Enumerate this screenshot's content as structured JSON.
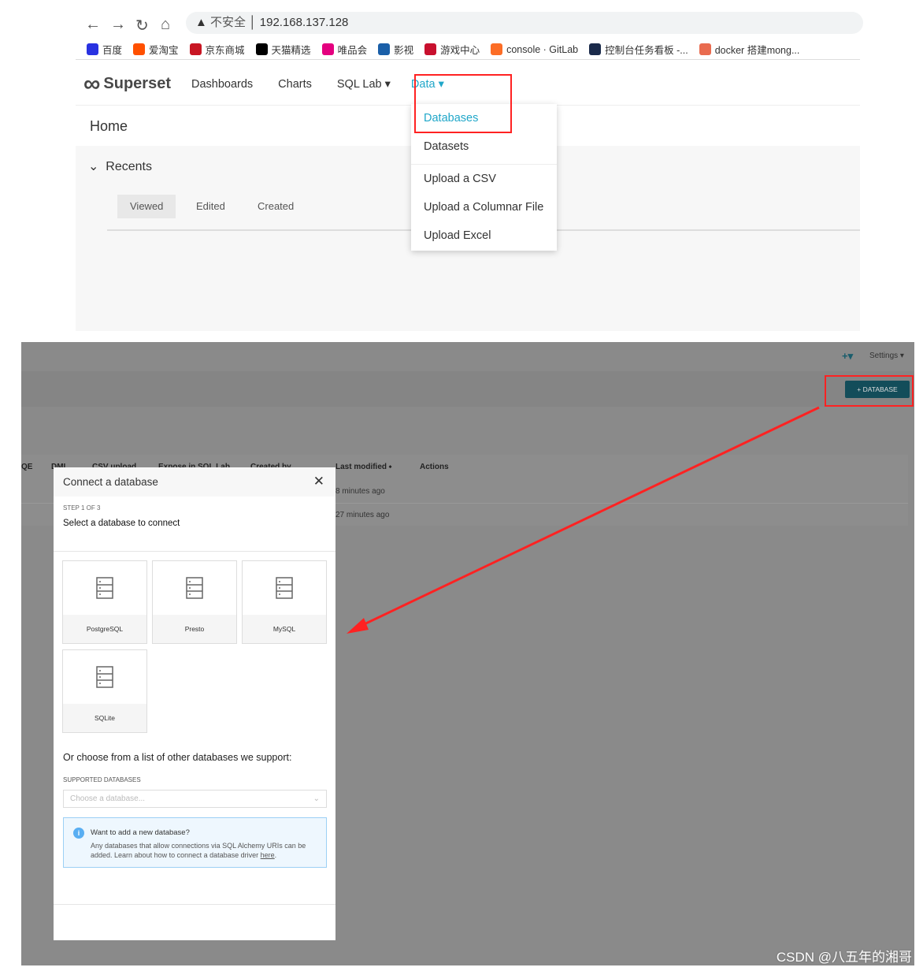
{
  "browser": {
    "security": "不安全",
    "url": "192.168.137.128",
    "bookmarks": [
      {
        "label": "百度",
        "color": "#2932e1"
      },
      {
        "label": "爱淘宝",
        "color": "#ff5000"
      },
      {
        "label": "京东商城",
        "color": "#c81623"
      },
      {
        "label": "天猫精选",
        "color": "#000"
      },
      {
        "label": "唯品会",
        "color": "#e4007f"
      },
      {
        "label": "影视",
        "color": "#1a5fa8"
      },
      {
        "label": "游戏中心",
        "color": "#c8102e"
      },
      {
        "label": "console · GitLab",
        "color": "#fc6d26"
      },
      {
        "label": "控制台任务看板 -...",
        "color": "#1a2a4a"
      },
      {
        "label": "docker 搭建mong...",
        "color": "#e96b4f"
      }
    ]
  },
  "superset": {
    "brand": "Superset",
    "menu": [
      "Dashboards",
      "Charts",
      "SQL Lab",
      "Data"
    ],
    "page_title": "Home",
    "recents": "Recents",
    "tabs": [
      "Viewed",
      "Edited",
      "Created"
    ],
    "data_menu": [
      "Databases",
      "Datasets",
      "Upload a CSV",
      "Upload a Columnar File",
      "Upload Excel"
    ],
    "accent": "#20a7c9"
  },
  "db_page": {
    "settings": "Settings",
    "add_button": "+ DATABASE",
    "columns": [
      "QE",
      "DML",
      "CSV upload",
      "Expose in SQL Lab",
      "Created by",
      "Last modified",
      "Actions"
    ],
    "rows": [
      "8 minutes ago",
      "27 minutes ago"
    ]
  },
  "modal": {
    "title": "Connect a database",
    "step": "STEP 1 OF 3",
    "subtitle": "Select a database to connect",
    "databases": [
      "PostgreSQL",
      "Presto",
      "MySQL",
      "SQLite"
    ],
    "other": "Or choose from a list of other databases we support:",
    "supported_label": "SUPPORTED DATABASES",
    "select_placeholder": "Choose a database...",
    "info_title": "Want to add a new database?",
    "info_text": "Any databases that allow connections via SQL Alchemy URIs can be added. Learn about how to connect a database driver ",
    "info_link": "here",
    "info_end": "."
  },
  "watermark": "CSDN @八五年的湘哥"
}
